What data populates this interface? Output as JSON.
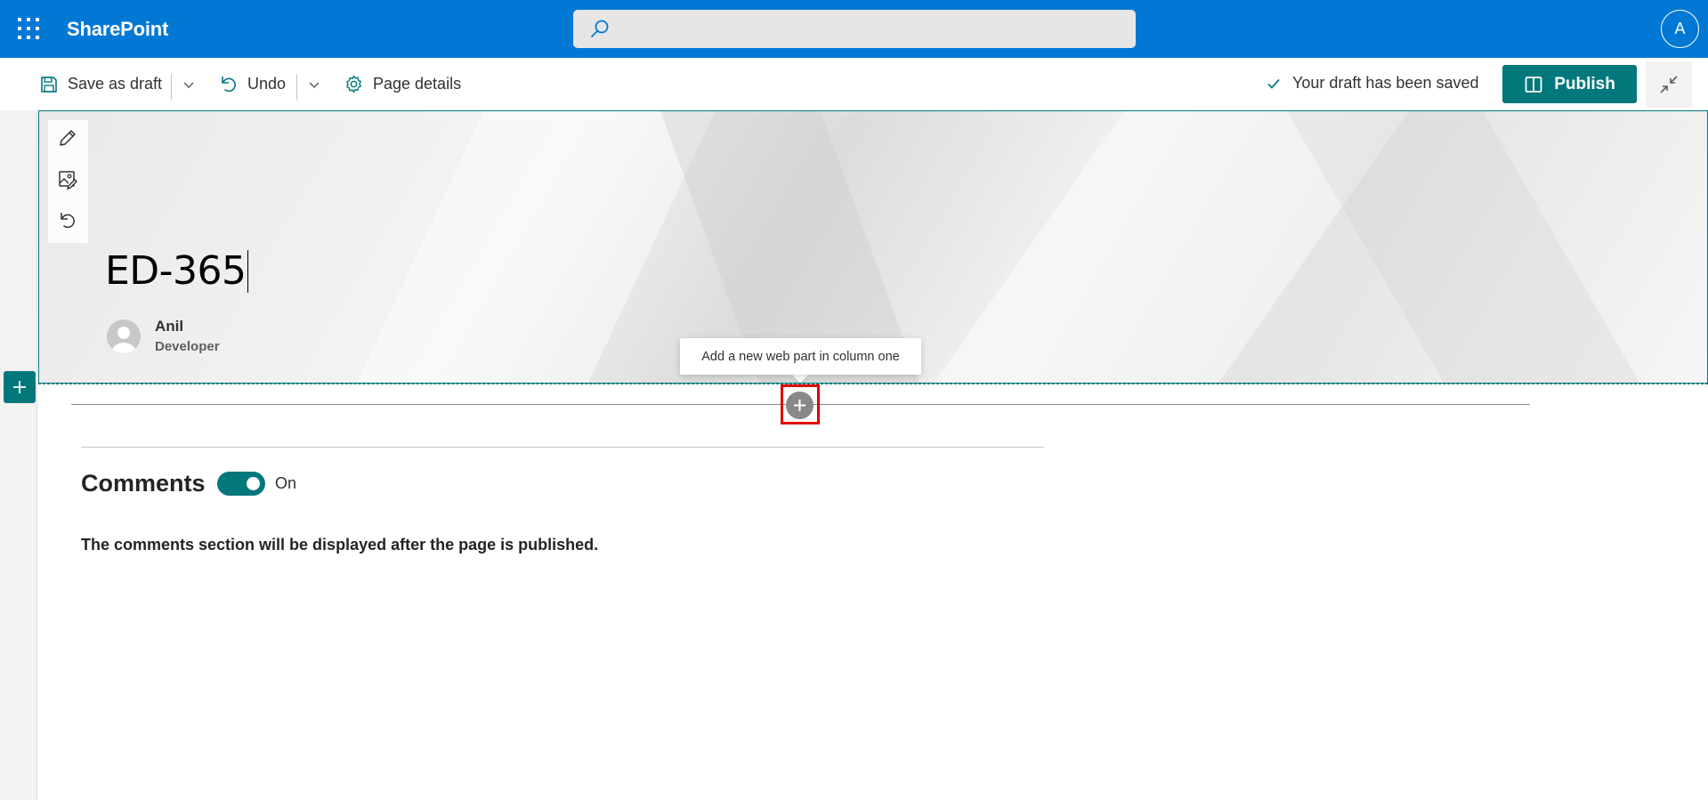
{
  "suite_bar": {
    "brand": "SharePoint",
    "search_placeholder": "",
    "user_initial": "A",
    "color": "#0078d4"
  },
  "command_bar": {
    "save_as_draft": "Save as draft",
    "undo": "Undo",
    "page_details": "Page details",
    "status": "Your draft has been saved",
    "publish": "Publish"
  },
  "hero": {
    "title": "ED-365",
    "author": {
      "name": "Anil",
      "role": "Developer"
    }
  },
  "canvas": {
    "add_webpart_tooltip": "Add a new web part in column one"
  },
  "comments": {
    "title": "Comments",
    "toggle_state": "On",
    "note": "The comments section will be displayed after the page is published."
  },
  "colors": {
    "accent": "#03787c",
    "suite": "#0078d4",
    "highlight": "#e00000"
  }
}
